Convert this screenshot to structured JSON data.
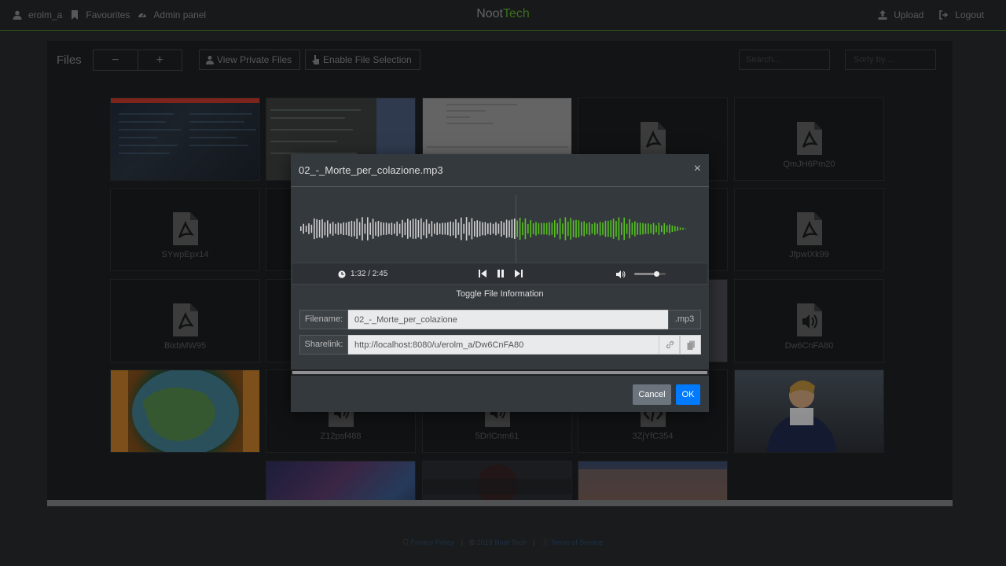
{
  "nav": {
    "user": "erolm_a",
    "favourites": "Favourites",
    "admin": "Admin panel",
    "brand_a": "Noot",
    "brand_b": "Tech",
    "upload": "Upload",
    "logout": "Logout"
  },
  "files": {
    "title": "Files",
    "zoom_out": "−",
    "zoom_in": "+",
    "view_private": "View Private Files",
    "enable_selection": "Enable File Selection",
    "search_placeholder": "Search...",
    "sort_placeholder": "Sorty by ..."
  },
  "tiles": [
    {
      "label": "",
      "kind": "image"
    },
    {
      "label": "",
      "kind": "image"
    },
    {
      "label": "",
      "kind": "image"
    },
    {
      "label": "",
      "kind": "pdf"
    },
    {
      "label": "QmJH6Pm20",
      "kind": "pdf"
    },
    {
      "label": "SYwpEpx14",
      "kind": "pdf"
    },
    {
      "label": "JfpwIXk99",
      "kind": "pdf"
    },
    {
      "label": "BixbMW95",
      "kind": "pdf"
    },
    {
      "label": "Dw6CnFA80",
      "kind": "audio"
    },
    {
      "label": "",
      "kind": "image"
    },
    {
      "label": "Z12psf488",
      "kind": "audio"
    },
    {
      "label": "5DrlCnm61",
      "kind": "audio"
    },
    {
      "label": "3ZjYfC354",
      "kind": "code"
    },
    {
      "label": "",
      "kind": "image"
    },
    {
      "label": "",
      "kind": "image"
    },
    {
      "label": "",
      "kind": "image"
    },
    {
      "label": "",
      "kind": "image"
    }
  ],
  "footer": {
    "privacy": "Privacy Policy",
    "copyright": "2019 Noot Tech",
    "terms": "Terms of Service"
  },
  "modal": {
    "title": "02_-_Morte_per_colazione.mp3",
    "close": "×",
    "time": "1:32 / 2:45",
    "progress": 0.5576,
    "volume": 0.7,
    "toggle_info": "Toggle File Information",
    "filename_label": "Filename:",
    "filename_value": "02_-_Morte_per_colazione",
    "filename_ext": ".mp3",
    "sharelink_label": "Sharelink:",
    "sharelink_value": "http://localhost:8080/u/erolm_a/Dw6CnFA80",
    "cancel": "Cancel",
    "ok": "OK"
  },
  "colors": {
    "accent": "#5fa92e",
    "waveform_played": "#cfcfcf",
    "waveform_unplayed": "#56c21e",
    "ok": "#007bff",
    "cancel": "#6c757d"
  }
}
